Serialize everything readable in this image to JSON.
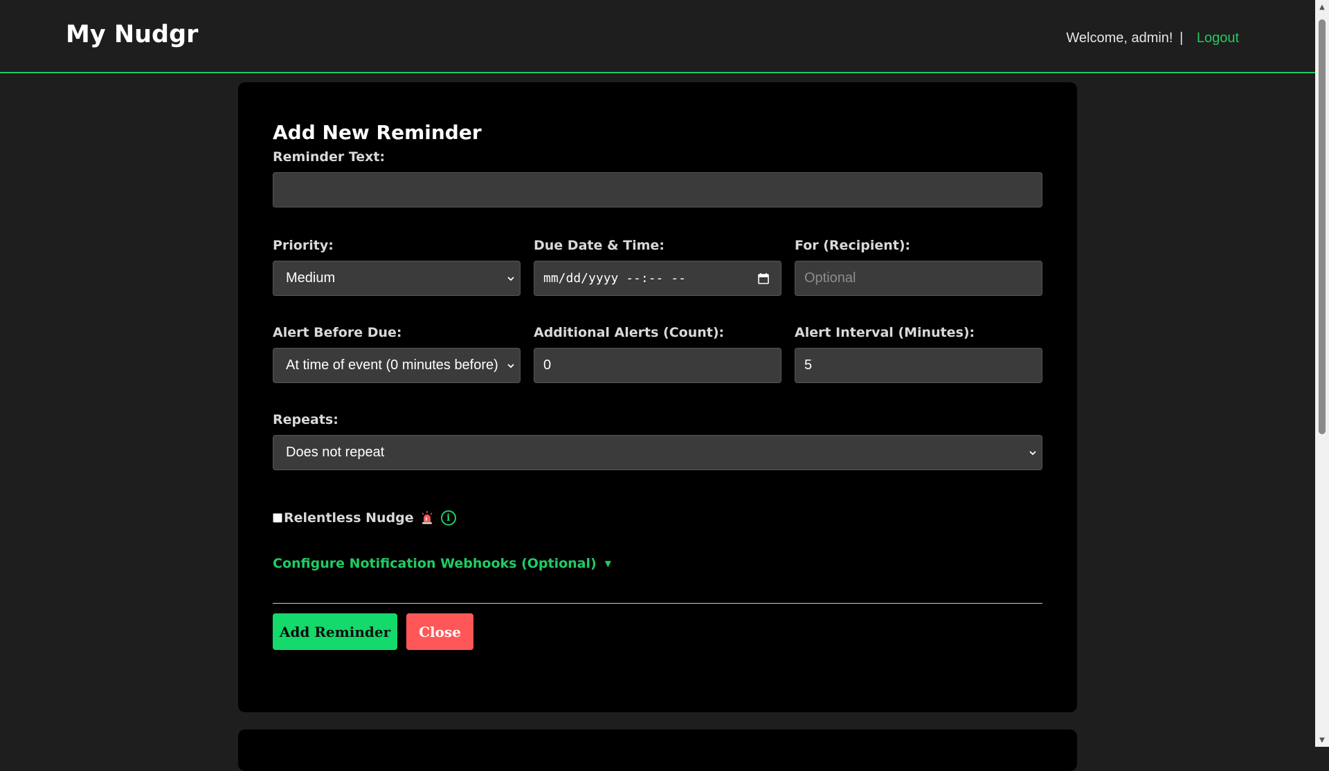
{
  "header": {
    "brand": "My Nudgr",
    "welcome": "Welcome, admin!",
    "separator": "|",
    "logout": "Logout"
  },
  "form": {
    "title": "Add New Reminder",
    "reminder_text_label": "Reminder Text:",
    "reminder_text_value": "",
    "priority_label": "Priority:",
    "priority_value": "Medium",
    "due_label": "Due Date & Time:",
    "due_placeholder": "mm/dd/yyyy --:-- --",
    "recipient_label": "For (Recipient):",
    "recipient_placeholder": "Optional",
    "alert_before_label": "Alert Before Due:",
    "alert_before_value": "At time of event (0 minutes before)",
    "additional_alerts_label": "Additional Alerts (Count):",
    "additional_alerts_value": "0",
    "alert_interval_label": "Alert Interval (Minutes):",
    "alert_interval_value": "5",
    "repeats_label": "Repeats:",
    "repeats_value": "Does not repeat",
    "relentless_label": "Relentless Nudge",
    "webhooks_label": "Configure Notification Webhooks (Optional)",
    "webhooks_arrow": "▼",
    "add_button": "Add Reminder",
    "close_button": "Close"
  },
  "colors": {
    "accent": "#1fcc63",
    "add_button": "#14d96b",
    "close_button": "#ff5757",
    "background": "#1e1e1e",
    "card": "#000000",
    "input": "#3b3b3b"
  },
  "icons": {
    "siren": "siren-icon",
    "info": "info-icon",
    "calendar": "calendar-icon",
    "chevron": "chevron-down-icon"
  }
}
